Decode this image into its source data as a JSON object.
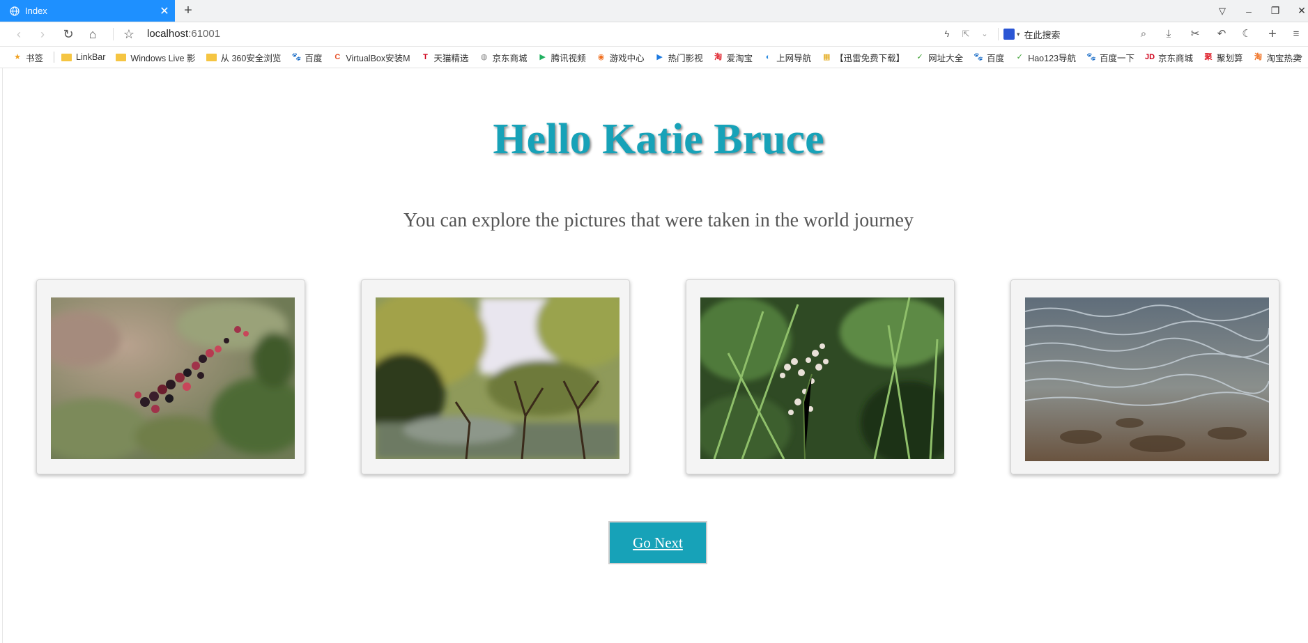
{
  "browser": {
    "tab_title": "Index",
    "new_tab_glyph": "+",
    "url_host": "localhost",
    "url_port": ":61001",
    "search_placeholder": "在此搜索",
    "window_controls": [
      "minimize",
      "restore",
      "close"
    ]
  },
  "bookmarks": [
    {
      "label": "书签",
      "icon": "star-icon",
      "color": "#f0a020"
    },
    {
      "label": "LinkBar",
      "icon": "folder-icon",
      "color": "#f5c542"
    },
    {
      "label": "Windows Live 影",
      "icon": "folder-icon",
      "color": "#f5c542"
    },
    {
      "label": "从 360安全浏览",
      "icon": "folder-icon",
      "color": "#f5c542"
    },
    {
      "label": "百度",
      "icon": "baidu-paw-icon",
      "color": "#2a55d4"
    },
    {
      "label": "VirtualBox安装M",
      "icon": "c-icon",
      "color": "#e8532b"
    },
    {
      "label": "天猫精选",
      "icon": "tmall-icon",
      "color": "#d0021b"
    },
    {
      "label": "京东商城",
      "icon": "globe-icon",
      "color": "#888888"
    },
    {
      "label": "腾讯视频",
      "icon": "play-icon",
      "color": "#20b060"
    },
    {
      "label": "游戏中心",
      "icon": "gamepad-icon",
      "color": "#f07020"
    },
    {
      "label": "热门影视",
      "icon": "video-icon",
      "color": "#1e7ae0"
    },
    {
      "label": "爱淘宝",
      "icon": "taobao-icon",
      "color": "#e0242e"
    },
    {
      "label": "上网导航",
      "icon": "compass-icon",
      "color": "#2a8ae0"
    },
    {
      "label": "【迅雷免费下载】",
      "icon": "grid-icon",
      "color": "#e0a000"
    },
    {
      "label": "网址大全",
      "icon": "hao-icon",
      "color": "#3aa030"
    },
    {
      "label": "百度",
      "icon": "baidu-paw-icon",
      "color": "#2a55d4"
    },
    {
      "label": "Hao123导航",
      "icon": "hao-icon",
      "color": "#3aa030"
    },
    {
      "label": "百度一下",
      "icon": "baidu-paw-icon",
      "color": "#2a55d4"
    },
    {
      "label": "京东商城",
      "icon": "jd-icon",
      "color": "#d0021b"
    },
    {
      "label": "聚划算",
      "icon": "juhuasuan-icon",
      "color": "#e0242e"
    },
    {
      "label": "淘宝热卖",
      "icon": "taobao-icon",
      "color": "#f07020"
    }
  ],
  "page": {
    "heading": "Hello Katie Bruce",
    "subtitle": "You can explore the pictures that were taken in the world journey",
    "accent_color": "#17a2b8",
    "photos": [
      {
        "subject": "blackberries"
      },
      {
        "subject": "orchard-trees"
      },
      {
        "subject": "wildflowers"
      },
      {
        "subject": "water-ripples"
      }
    ],
    "next_button": "Go Next"
  }
}
